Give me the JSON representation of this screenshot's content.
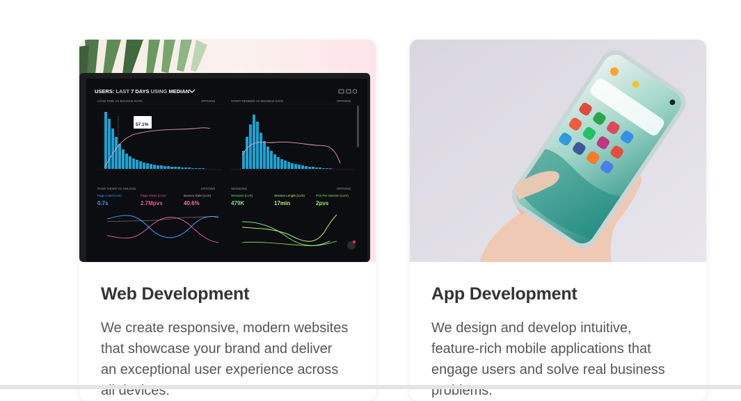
{
  "cards": [
    {
      "title": "Web Development",
      "description": "We create responsive, modern websites that showcase your brand and deliver an exceptional user experience across all devices.",
      "image": {
        "header_prefix": "USERS:",
        "header_last": "LAST",
        "header_days": "7 DAYS",
        "header_using": "USING",
        "header_metric": "MEDIAN",
        "options": "OPTIONS",
        "panel_load_bounce": "LOAD TIME VS BOUNCE RATE",
        "panel_render_bounce": "START RENDER VS BOUNCE RATE",
        "panel_page_views": "PAGE VIEWS VS ONLOAD",
        "panel_sessions": "SESSIONS",
        "tooltip_value": "57.1%",
        "metric_page_load_label": "Page Load (LUX)",
        "metric_page_load_value": "0.7s",
        "metric_page_views_label": "Page Views (LUX)",
        "metric_page_views_value": "2.7Mpvs",
        "metric_bounce_label": "Bounce Rate (LUX)",
        "metric_bounce_value": "40.6%",
        "metric_sessions_label": "Sessions (LUX)",
        "metric_sessions_value": "479K",
        "metric_session_length_label": "Session Length (LUX)",
        "metric_session_length_value": "17min",
        "metric_pvs_label": "PVs Per Session (LUX)",
        "metric_pvs_value": "2pvs"
      }
    },
    {
      "title": "App Development",
      "description": "We design and develop intuitive, feature-rich mobile applications that engage users and solve real business problems."
    }
  ],
  "colors": {
    "title": "#333333",
    "text": "#555555",
    "dashboard_bg": "#0b0d10",
    "bar_blue": "#1aa3d6",
    "line_pink": "#e8a0b4",
    "metric_blue": "#3aa0ff",
    "metric_pink": "#e05aa0",
    "metric_green": "#7be08a"
  }
}
